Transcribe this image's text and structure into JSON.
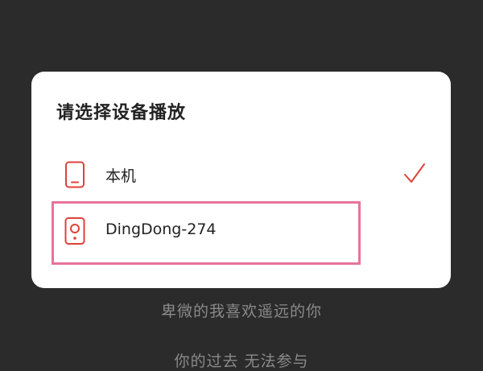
{
  "background": {
    "color": "#2b2b2b",
    "lyrics": [
      "卑微的我喜欢遥远的你",
      "你的过去 无法参与"
    ]
  },
  "dialog": {
    "title": "请选择设备播放",
    "options": [
      {
        "label": "本机",
        "icon": "phone-icon",
        "selected": true
      },
      {
        "label": "DingDong-274",
        "icon": "speaker-icon",
        "selected": false
      }
    ],
    "selected_check_icon": "checkmark-icon"
  },
  "colors": {
    "accent": "#e0413a",
    "highlight": "#e8739b",
    "dialog_bg": "#ffffff",
    "title_text": "#222222"
  }
}
